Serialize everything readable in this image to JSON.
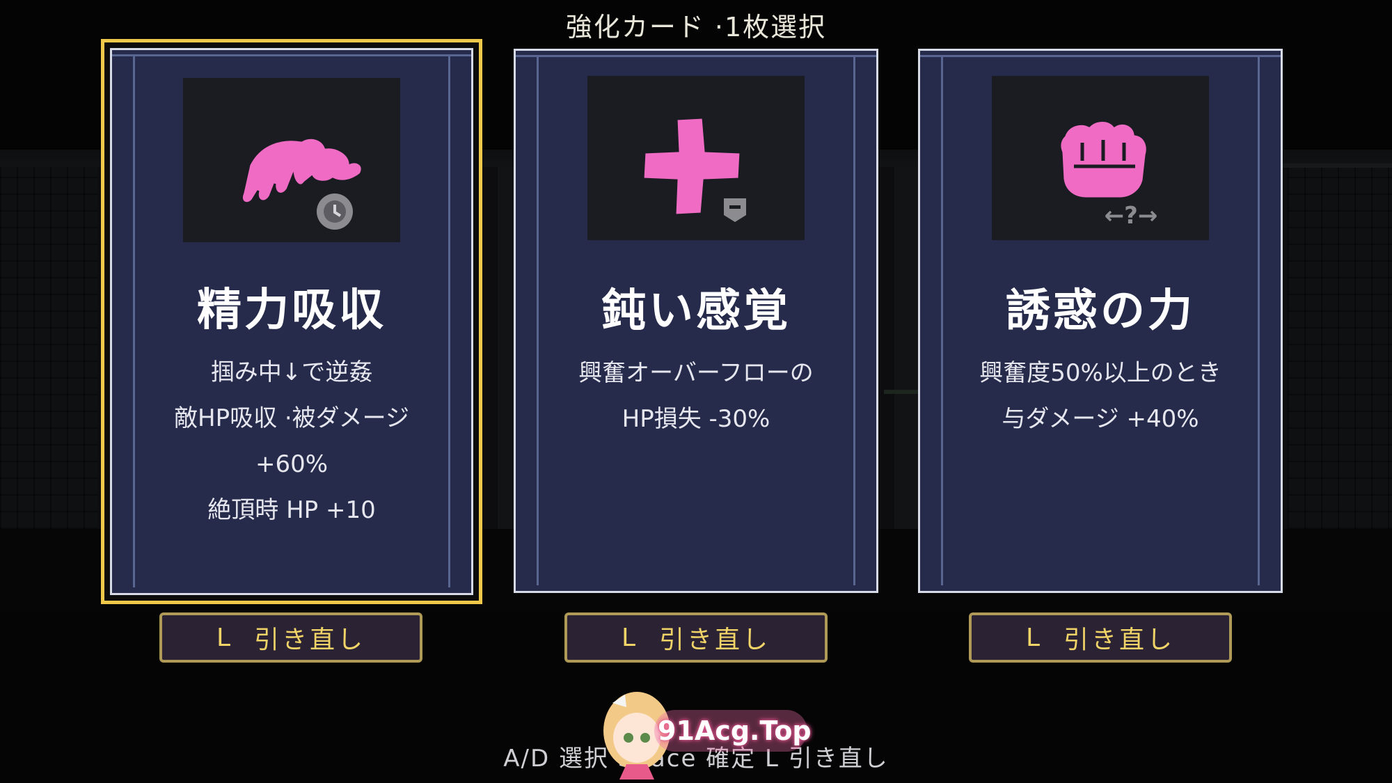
{
  "header": {
    "title": "強化カード ·1枚選択"
  },
  "cards": [
    {
      "name": "精力吸収",
      "icon": "grabbing-hand-icon",
      "badge": "clock-icon",
      "description": [
        "掴み中↓で逆姦",
        "敵HP吸収 ·被ダメージ",
        "+60%",
        "絶頂時 HP +10"
      ],
      "selected": true
    },
    {
      "name": "鈍い感覚",
      "icon": "plus-cross-icon",
      "badge": "shield-icon",
      "description": [
        "興奮オーバーフローの",
        "HP損失 -30%"
      ],
      "selected": false
    },
    {
      "name": "誘惑の力",
      "icon": "fist-icon",
      "badge": "direction-unknown-icon",
      "badge_text": "←?→",
      "description": [
        "興奮度50%以上のとき",
        "与ダメージ +40%"
      ],
      "selected": false
    }
  ],
  "redraw": {
    "key": "L",
    "label": "引き直し"
  },
  "footer": {
    "hint": "A/D 選択 Space 確定 L 引き直し"
  },
  "watermark": {
    "text": "91Acg.Top"
  },
  "colors": {
    "card_bg": "#262b4b",
    "selected_border": "#f0c94a",
    "icon_pink": "#f06cc4",
    "button_text": "#f1d468"
  }
}
